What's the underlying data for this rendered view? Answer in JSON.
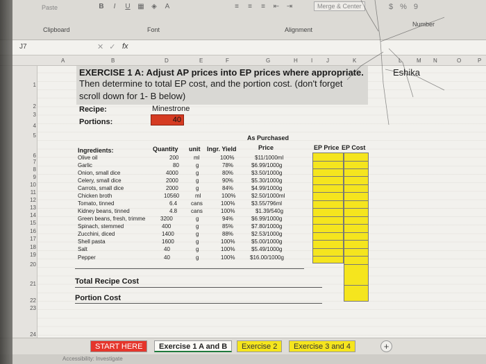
{
  "ribbon": {
    "paste_label": "Paste",
    "font_buttons": [
      "B",
      "I",
      "U"
    ],
    "merge_label": "Merge & Center",
    "number_symbols": [
      "$",
      "%",
      "9"
    ],
    "group_labels": {
      "clipboard": "Clipboard",
      "font": "Font",
      "alignment": "Alignment",
      "number": "Number"
    }
  },
  "formula_bar": {
    "name_box": "J7",
    "fx": "fx"
  },
  "columns": [
    "A",
    "B",
    "D",
    "E",
    "F",
    "G",
    "H",
    "I",
    "J",
    "K",
    "L",
    "M",
    "N",
    "O",
    "P"
  ],
  "rows": [
    "1",
    "2",
    "3",
    "4",
    "5",
    "6",
    "7",
    "8",
    "9",
    "10",
    "11",
    "12",
    "13",
    "14",
    "15",
    "16",
    "17",
    "18",
    "19",
    "20",
    "21",
    "22",
    "23",
    "24"
  ],
  "exercise": {
    "line1": "EXERCISE 1 A: Adjust AP prices into EP prices where appropriate.",
    "line2": "Then determine to total EP cost, and the portion cost. (don't forget",
    "line3": "scroll down for 1- B below)",
    "recipe_label": "Recipe:",
    "recipe_value": "Minestrone",
    "portions_label": "Portions:",
    "portions_value": "40",
    "student_name": "Eshika"
  },
  "table": {
    "headers": {
      "ingredients": "Ingredients:",
      "quantity": "Quantity",
      "unit": "unit",
      "yield": "Ingr. Yield",
      "ap_top": "As Purchased",
      "ap_bottom": "Price",
      "ep_price": "EP Price",
      "ep_cost": "EP Cost"
    },
    "rows": [
      {
        "ingredient": "Olive oil",
        "quantity": "200",
        "unit": "ml",
        "yield": "100%",
        "price": "$11/1000ml"
      },
      {
        "ingredient": "Garlic",
        "quantity": "80",
        "unit": "g",
        "yield": "78%",
        "price": "$6.99/1000g"
      },
      {
        "ingredient": "Onion, small dice",
        "quantity": "4000",
        "unit": "g",
        "yield": "80%",
        "price": "$3.50/1000g"
      },
      {
        "ingredient": "Celery, small dice",
        "quantity": "2000",
        "unit": "g",
        "yield": "90%",
        "price": "$5.30/1000g"
      },
      {
        "ingredient": "Carrots, small dice",
        "quantity": "2000",
        "unit": "g",
        "yield": "84%",
        "price": "$4.99/1000g"
      },
      {
        "ingredient": "Chicken broth",
        "quantity": "10560",
        "unit": "ml",
        "yield": "100%",
        "price": "$2.50/1000ml"
      },
      {
        "ingredient": "Tomato, tinned",
        "quantity": "6.4",
        "unit": "cans",
        "yield": "100%",
        "price": "$3.55/796ml"
      },
      {
        "ingredient": "Kidney beans, tinned",
        "quantity": "4.8",
        "unit": "cans",
        "yield": "100%",
        "price": "$1.39/540g"
      },
      {
        "ingredient": "Green beans, fresh, trimme",
        "quantity": "3200",
        "unit": "g",
        "yield": "94%",
        "price": "$6.99/1000g"
      },
      {
        "ingredient": "Spinach, stemmed",
        "quantity": "400",
        "unit": "g",
        "yield": "85%",
        "price": "$7.80/1000g"
      },
      {
        "ingredient": "Zucchini, diced",
        "quantity": "1400",
        "unit": "g",
        "yield": "88%",
        "price": "$2.53/1000g"
      },
      {
        "ingredient": "Shell pasta",
        "quantity": "1600",
        "unit": "g",
        "yield": "100%",
        "price": "$5.00/1000g"
      },
      {
        "ingredient": "Salt",
        "quantity": "40",
        "unit": "g",
        "yield": "100%",
        "price": "$5.49/1000g"
      },
      {
        "ingredient": "Pepper",
        "quantity": "40",
        "unit": "g",
        "yield": "100%",
        "price": "$16.00/1000g"
      }
    ],
    "total_recipe_cost_label": "Total Recipe Cost",
    "portion_cost_label": "Portion Cost"
  },
  "sheet_tabs": [
    {
      "label": "START HERE"
    },
    {
      "label": "Exercise 1 A and B"
    },
    {
      "label": "Exercise 2"
    },
    {
      "label": "Exercise 3 and 4"
    }
  ],
  "status_bar": {
    "text": "Accessibility: Investigate"
  },
  "colors": {
    "portions_fill": "#d53b22",
    "yellow_fill": "#f5e51e",
    "start_tab": "#e5352b",
    "active_tab_underline": "#1f7a3c"
  }
}
